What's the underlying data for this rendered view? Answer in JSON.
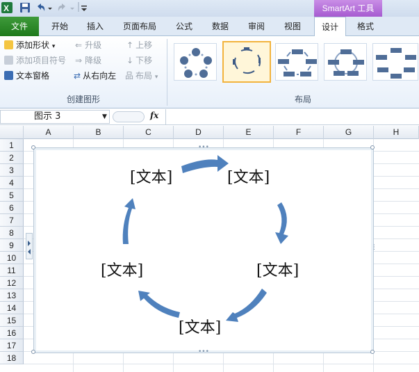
{
  "titlebar": {
    "icons": [
      "excel-logo-icon",
      "save-icon",
      "undo-icon",
      "redo-icon",
      "customize-qat-icon"
    ],
    "context_tab": "SmartArt 工具"
  },
  "tabs": [
    {
      "label": "文件",
      "active": false
    },
    {
      "label": "开始",
      "active": false
    },
    {
      "label": "插入",
      "active": false
    },
    {
      "label": "页面布局",
      "active": false
    },
    {
      "label": "公式",
      "active": false
    },
    {
      "label": "数据",
      "active": false
    },
    {
      "label": "审阅",
      "active": false
    },
    {
      "label": "视图",
      "active": false
    },
    {
      "label": "设计",
      "active": true
    },
    {
      "label": "格式",
      "active": false
    }
  ],
  "ribbon": {
    "create_group": {
      "label": "创建图形",
      "add_shape": "添加形状",
      "add_bullet": "添加项目符号",
      "text_pane": "文本窗格",
      "promote": "升级",
      "demote": "降级",
      "right_to_left": "从右向左",
      "move_up": "上移",
      "move_down": "下移",
      "layout": "布局"
    },
    "layout_group": {
      "label": "布局",
      "thumbnails": [
        "basic-cycle",
        "circular-arrows",
        "block-cycle",
        "segmented-cycle",
        "multidirectional-cycle"
      ],
      "selected_index": 1
    }
  },
  "formula_bar": {
    "name_box": "图示 3",
    "fx": "fx",
    "formula": ""
  },
  "columns": [
    "A",
    "B",
    "C",
    "D",
    "E",
    "F",
    "G",
    "H"
  ],
  "rows": [
    "1",
    "2",
    "3",
    "4",
    "5",
    "6",
    "7",
    "8",
    "9",
    "10",
    "11",
    "12",
    "13",
    "14",
    "15",
    "16",
    "17",
    "18"
  ],
  "smartart": {
    "nodes": [
      "[文本]",
      "[文本]",
      "[文本]",
      "[文本]",
      "[文本]"
    ],
    "arrow_color": "#4f81bd"
  },
  "colors": {
    "file_tab": "#1f7a1c",
    "context_tab": "#a65bd0",
    "selected_layout": "#f2b33d"
  }
}
